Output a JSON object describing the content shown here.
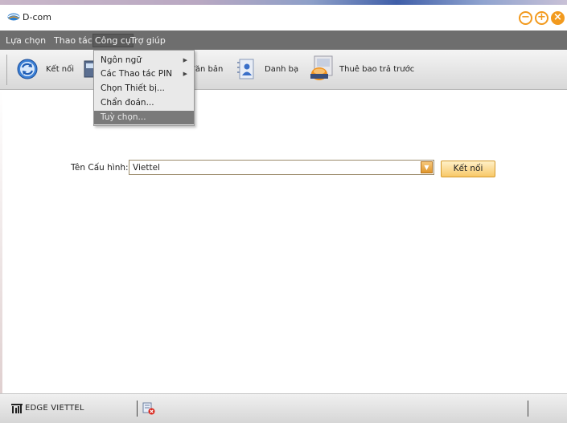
{
  "window": {
    "title": "D-com"
  },
  "menu": {
    "items": [
      {
        "label": "Lựa chọn"
      },
      {
        "label": "Thao tác"
      },
      {
        "label": "Công cụ"
      },
      {
        "label": "Trợ giúp"
      }
    ]
  },
  "toolbar": {
    "items": [
      {
        "label": "Kết nối",
        "icon": "refresh-icon"
      },
      {
        "label": "Văn bản",
        "icon": "message-icon"
      },
      {
        "label": "Danh bạ",
        "icon": "contacts-icon"
      },
      {
        "label": "Thuê bao trả trước",
        "icon": "prepaid-icon"
      }
    ]
  },
  "dropdown": {
    "items": [
      {
        "label": "Ngôn ngữ",
        "submenu": true
      },
      {
        "label": "Các Thao tác PIN",
        "submenu": true
      },
      {
        "label": "Chọn Thiết bị..."
      },
      {
        "label": "Chẩn đoán..."
      },
      {
        "label": "Tuỳ chọn..."
      }
    ],
    "selected_index": 4
  },
  "config": {
    "label": "Tên Cấu hình:",
    "value": "Viettel",
    "connect_label": "Kết nối"
  },
  "status": {
    "network": "EDGE VIETTEL"
  },
  "colors": {
    "accent": "#f29a1e",
    "menubar": "#6e6e6e",
    "selected": "#7a7a7a"
  }
}
